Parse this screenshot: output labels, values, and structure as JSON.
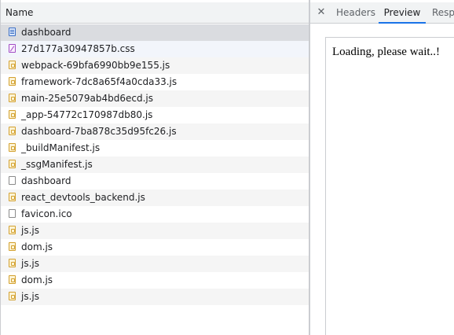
{
  "network_list": {
    "column_header": "Name",
    "requests": [
      {
        "name": "dashboard",
        "icon": "document-icon",
        "state": "selected"
      },
      {
        "name": "27d177a30947857b.css",
        "icon": "css-file-icon",
        "state": "normal"
      },
      {
        "name": "webpack-69bfa6990bb9e155.js",
        "icon": "js-file-icon",
        "state": "alt"
      },
      {
        "name": "framework-7dc8a65f4a0cda33.js",
        "icon": "js-file-icon",
        "state": "normal"
      },
      {
        "name": "main-25e5079ab4bd6ecd.js",
        "icon": "js-file-icon",
        "state": "alt"
      },
      {
        "name": "_app-54772c170987db80.js",
        "icon": "js-file-icon",
        "state": "normal"
      },
      {
        "name": "dashboard-7ba878c35d95fc26.js",
        "icon": "js-file-icon",
        "state": "alt"
      },
      {
        "name": "_buildManifest.js",
        "icon": "js-file-icon",
        "state": "normal"
      },
      {
        "name": "_ssgManifest.js",
        "icon": "js-file-icon",
        "state": "alt"
      },
      {
        "name": "dashboard",
        "icon": "blank-file-icon",
        "state": "normal"
      },
      {
        "name": "react_devtools_backend.js",
        "icon": "js-file-icon",
        "state": "alt"
      },
      {
        "name": "favicon.ico",
        "icon": "blank-file-icon",
        "state": "normal"
      },
      {
        "name": "js.js",
        "icon": "js-file-icon",
        "state": "alt"
      },
      {
        "name": "dom.js",
        "icon": "js-file-icon",
        "state": "normal"
      },
      {
        "name": "js.js",
        "icon": "js-file-icon",
        "state": "alt"
      },
      {
        "name": "dom.js",
        "icon": "js-file-icon",
        "state": "normal"
      },
      {
        "name": "js.js",
        "icon": "js-file-icon",
        "state": "alt"
      }
    ]
  },
  "details": {
    "close_glyph": "✕",
    "tabs": [
      {
        "label": "Headers",
        "active": false
      },
      {
        "label": "Preview",
        "active": true
      },
      {
        "label": "Resp",
        "active": false
      }
    ],
    "preview_text": "Loading, please wait..!"
  },
  "colors": {
    "selected_row": "#dadce0",
    "alt_row": "#f5f5f5",
    "active_tab_underline": "#1a73e8",
    "js_icon": "#d3a130",
    "css_icon": "#a24ec4",
    "document_icon": "#3b6fc4"
  }
}
